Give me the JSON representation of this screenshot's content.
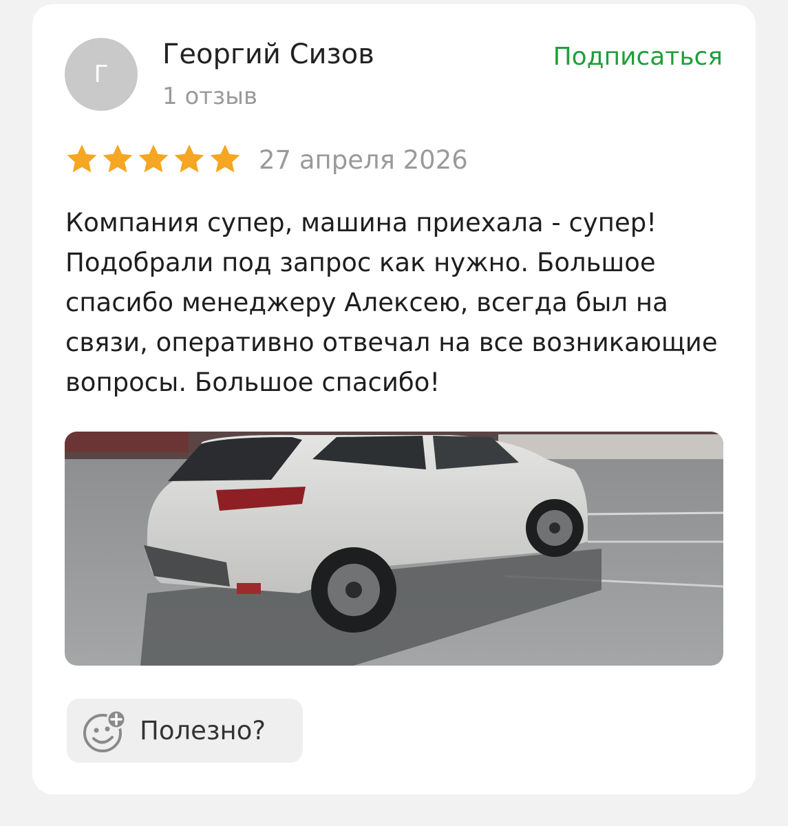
{
  "author": {
    "avatar_letter": "Г",
    "name": "Георгий Сизов",
    "review_count": "1 отзыв"
  },
  "subscribe_label": "Подписаться",
  "review": {
    "rating": 5,
    "max_rating": 5,
    "date": "27 апреля 2026",
    "text": "Компания супер, машина приехала - супер! Подобрали под запрос как нужно. Большое спасибо менеджеру Алексею, всегда был на связи, оперативно отвечал на все возникающие вопросы. Большое спасибо!"
  },
  "photo": {
    "icon": "car-photo"
  },
  "helpful": {
    "label": "Полезно?",
    "icon": "smiley-plus-icon"
  },
  "colors": {
    "accent_green": "#1f9e3a",
    "star_gold": "#f5a623",
    "avatar_gray": "#c9c9c9"
  }
}
